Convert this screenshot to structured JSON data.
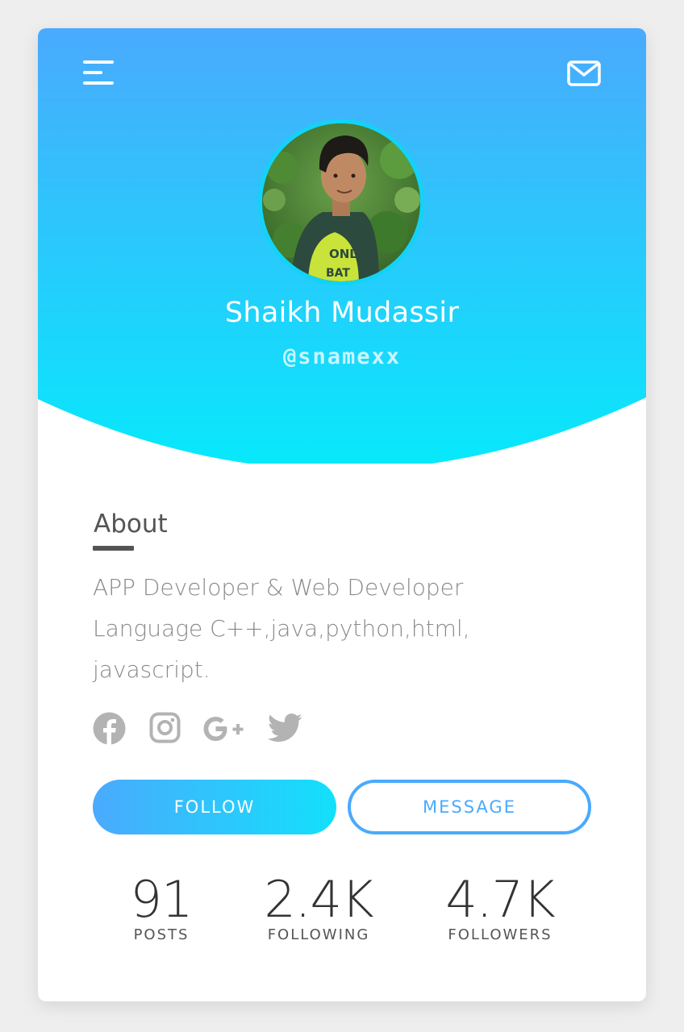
{
  "header": {
    "menu_icon": "hamburger-menu-icon",
    "mail_icon": "envelope-icon",
    "gradient_top": "#4aaafd",
    "gradient_bottom": "#07e9fb"
  },
  "profile": {
    "name": "Shaikh Mudassir",
    "handle": "@snamexx",
    "avatar_shirt_text_1": "ONLY",
    "avatar_shirt_text_2": "BAT"
  },
  "about": {
    "title": "About",
    "bio_lines": [
      "APP Developer & Web Developer",
      "Language C++,java,python,html,",
      "javascript."
    ]
  },
  "socials": [
    {
      "name": "facebook-icon"
    },
    {
      "name": "instagram-icon"
    },
    {
      "name": "google-plus-icon"
    },
    {
      "name": "twitter-icon"
    }
  ],
  "buttons": {
    "follow": "FOLLOW",
    "message": "MESSAGE"
  },
  "stats": [
    {
      "value": "91",
      "label": "POSTS"
    },
    {
      "value": "2.4K",
      "label": "FOLLOWING"
    },
    {
      "value": "4.7K",
      "label": "FOLLOWERS"
    }
  ],
  "colors": {
    "accent": "#4aaafd",
    "text_dark": "#545454",
    "text_muted": "#8a8a8a",
    "icon_gray": "#b3b3b3"
  }
}
